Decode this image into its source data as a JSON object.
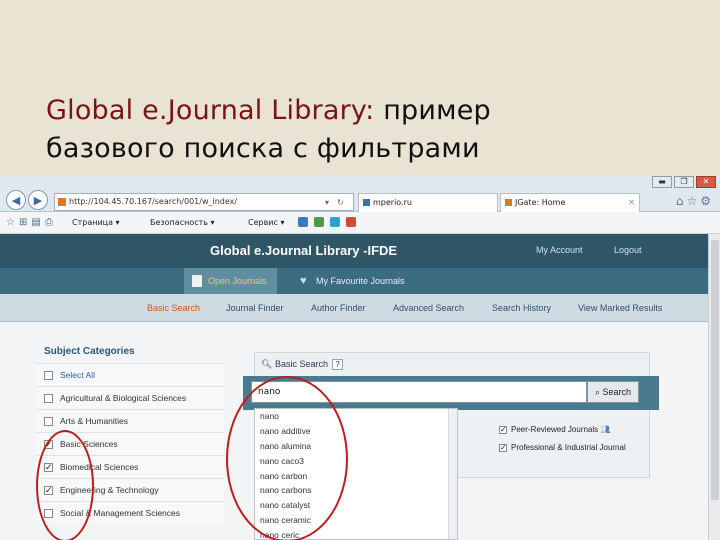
{
  "slide": {
    "title_en": "Global e.Journal Library:",
    "title_ru_1": " пример",
    "title_ru_2": "базового поиска с фильтрами"
  },
  "browser": {
    "url": "http://104.45.70.167/search/001/w_index/",
    "tabs": [
      {
        "label": "mperio.ru"
      },
      {
        "label": "JGate: Home"
      }
    ],
    "window_controls": [
      "▬",
      "❐",
      "✕"
    ],
    "command_bar": {
      "page_menu": "Страница",
      "safety_menu": "Безопасность",
      "service_menu": "Сервис"
    }
  },
  "site": {
    "title": "Global e.Journal Library -IFDE",
    "my_account": "My Account",
    "logout": "Logout",
    "tabs": [
      {
        "label": "Open Journals"
      },
      {
        "label": "My Favourite Journals"
      }
    ],
    "subnav": [
      {
        "label": "Basic Search"
      },
      {
        "label": "Journal Finder"
      },
      {
        "label": "Author Finder"
      },
      {
        "label": "Advanced Search"
      },
      {
        "label": "Search History"
      },
      {
        "label": "View Marked Results"
      }
    ]
  },
  "subjects": {
    "title": "Subject Categories",
    "items": [
      {
        "label": "Select All",
        "checked": false
      },
      {
        "label": "Agricultural & Biological Sciences",
        "checked": false
      },
      {
        "label": "Arts & Humanities",
        "checked": false
      },
      {
        "label": "Basic Sciences",
        "checked": true
      },
      {
        "label": "Biomedical Sciences",
        "checked": true
      },
      {
        "label": "Engineering & Technology",
        "checked": true
      },
      {
        "label": "Social & Management Sciences",
        "checked": false
      }
    ]
  },
  "search": {
    "label": "Basic Search",
    "help": "?",
    "value": "nano",
    "button_label": "Search",
    "filters": [
      {
        "label": "Peer-Reviewed Journals",
        "checked": true
      },
      {
        "label": "Professional & Industrial Journal",
        "checked": true
      }
    ],
    "suggestions": [
      "nano",
      "nano additive",
      "nano alumina",
      "nano caco3",
      "nano carbon",
      "nano carbons",
      "nano catalyst",
      "nano ceramic",
      "nano ceric"
    ]
  },
  "colors": {
    "site_header": "#2e5667",
    "site_tabs": "#3c6c80",
    "active_tab": "#5f8ea1",
    "active_link": "#d0541a",
    "annotation": "#c11c1c"
  }
}
